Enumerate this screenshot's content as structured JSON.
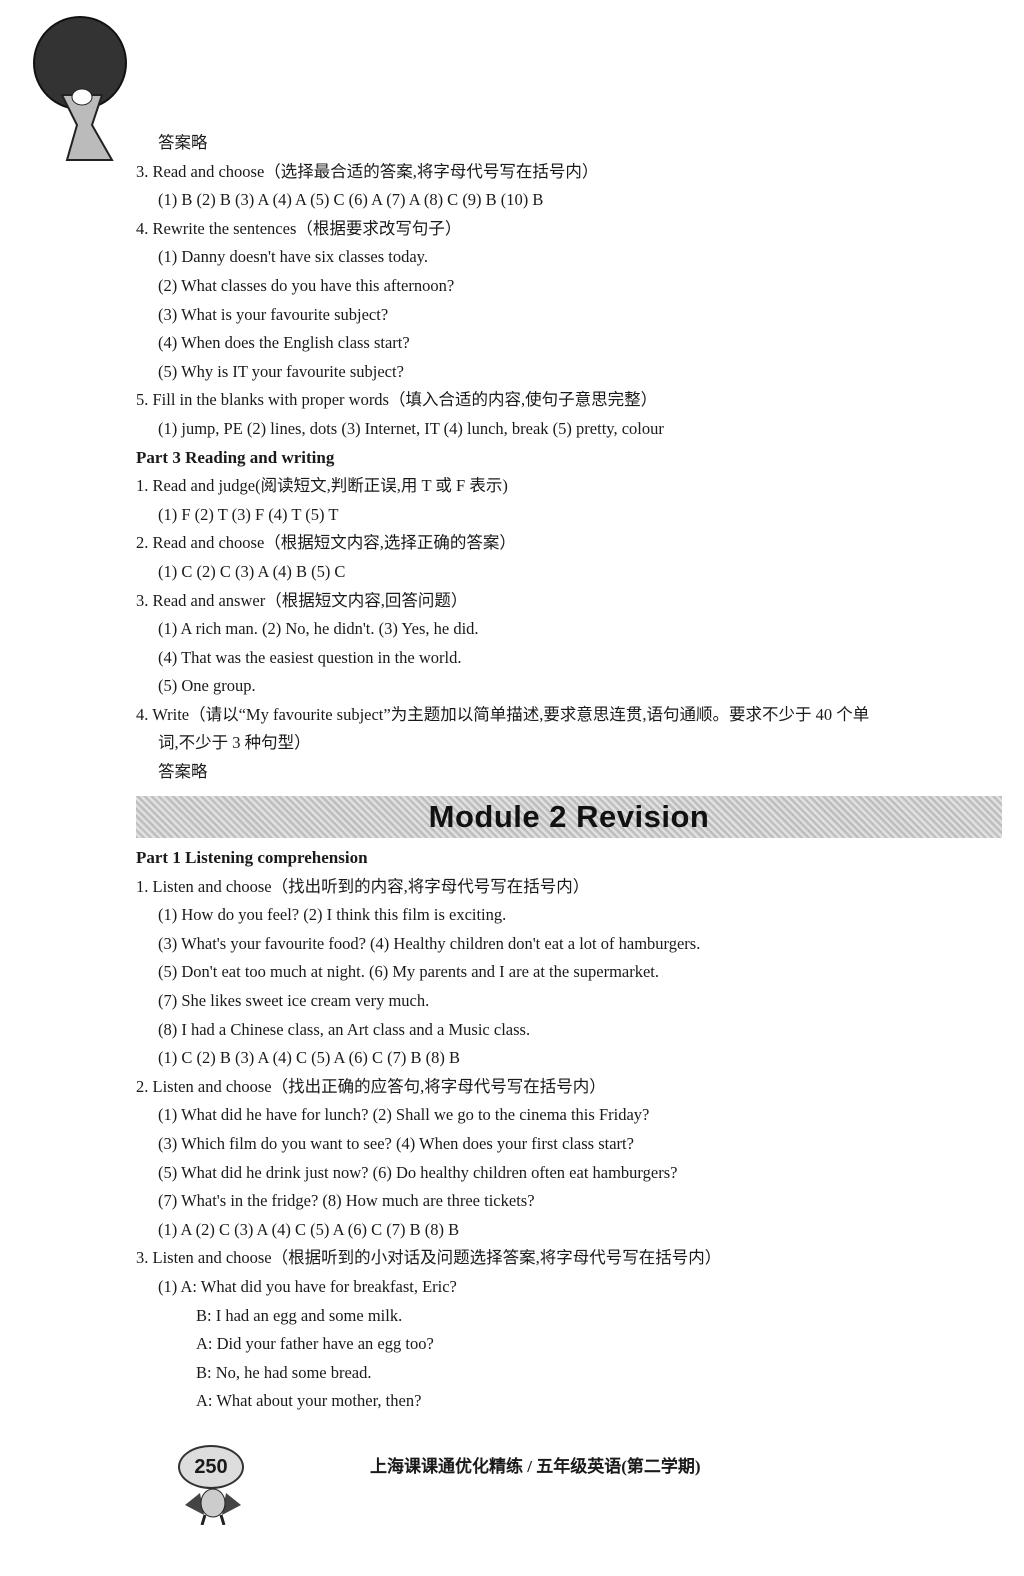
{
  "section_a": [
    {
      "t": "答案略",
      "c": "ind"
    },
    {
      "t": "3. Read and choose（选择最合适的答案,将字母代号写在括号内）",
      "c": ""
    },
    {
      "t": "(1) B   (2) B   (3) A   (4) A   (5) C   (6) A   (7) A   (8) C   (9) B   (10) B",
      "c": "ind"
    },
    {
      "t": "4. Rewrite the sentences（根据要求改写句子）",
      "c": ""
    },
    {
      "t": "(1)  Danny doesn't have six classes today.",
      "c": "ind"
    },
    {
      "t": "(2)  What classes do you have this afternoon?",
      "c": "ind"
    },
    {
      "t": "(3)  What is your favourite subject?",
      "c": "ind"
    },
    {
      "t": "(4)  When does the English class start?",
      "c": "ind"
    },
    {
      "t": "(5)  Why is IT your favourite subject?",
      "c": "ind"
    },
    {
      "t": "5. Fill in the blanks with proper words（填入合适的内容,使句子意思完整）",
      "c": ""
    },
    {
      "t": "(1) jump, PE   (2) lines, dots   (3) Internet, IT   (4) lunch, break   (5) pretty, colour",
      "c": "ind"
    },
    {
      "t": "Part 3    Reading and writing",
      "c": "head"
    },
    {
      "t": "1. Read and judge(阅读短文,判断正误,用 T 或 F 表示)",
      "c": ""
    },
    {
      "t": "(1) F   (2) T   (3) F   (4) T   (5) T",
      "c": "ind"
    },
    {
      "t": "2. Read and choose（根据短文内容,选择正确的答案）",
      "c": ""
    },
    {
      "t": "(1) C   (2) C   (3) A   (4) B   (5) C",
      "c": "ind"
    },
    {
      "t": "3. Read and answer（根据短文内容,回答问题）",
      "c": ""
    },
    {
      "t": "(1)  A rich man.   (2)  No, he didn't.   (3)  Yes, he did.",
      "c": "ind"
    },
    {
      "t": "(4)  That was the easiest question in the world.",
      "c": "ind"
    },
    {
      "t": "(5)  One group.",
      "c": "ind"
    },
    {
      "t": "4. Write（请以“My favourite subject”为主题加以简单描述,要求意思连贯,语句通顺。要求不少于 40 个单",
      "c": ""
    },
    {
      "t": "词,不少于 3 种句型）",
      "c": "ind"
    },
    {
      "t": "答案略",
      "c": "ind"
    }
  ],
  "module_title": "Module 2    Revision",
  "section_b": [
    {
      "t": "Part 1    Listening comprehension",
      "c": "head"
    },
    {
      "t": "1. Listen and choose（找出听到的内容,将字母代号写在括号内）",
      "c": ""
    },
    {
      "t": "(1)  How do you feel?    (2)  I think this film is exciting.",
      "c": "ind"
    },
    {
      "t": "(3)  What's your favourite food?    (4)  Healthy children don't eat a lot of hamburgers.",
      "c": "ind"
    },
    {
      "t": "(5)  Don't eat too much at night.    (6)  My parents and I are at the supermarket.",
      "c": "ind"
    },
    {
      "t": "(7)  She likes sweet ice cream very much.",
      "c": "ind"
    },
    {
      "t": "(8)  I had a Chinese class, an Art class and a Music class.",
      "c": "ind"
    },
    {
      "t": "(1) C   (2) B   (3) A   (4) C   (5) A   (6) C   (7) B   (8) B",
      "c": "ind"
    },
    {
      "t": "2. Listen and choose（找出正确的应答句,将字母代号写在括号内）",
      "c": ""
    },
    {
      "t": "(1)  What did he have for lunch?    (2)  Shall we go to the cinema this Friday?",
      "c": "ind"
    },
    {
      "t": "(3)  Which film do you want to see?    (4)  When does your first class start?",
      "c": "ind"
    },
    {
      "t": "(5)  What did he drink just now?    (6)  Do healthy children often eat hamburgers?",
      "c": "ind"
    },
    {
      "t": "(7)  What's in the fridge?    (8)  How much are three tickets?",
      "c": "ind"
    },
    {
      "t": "(1) A   (2) C   (3) A   (4) C   (5) A   (6) C   (7) B   (8) B",
      "c": "ind"
    },
    {
      "t": "3. Listen and choose（根据听到的小对话及问题选择答案,将字母代号写在括号内）",
      "c": ""
    },
    {
      "t": "(1)  A: What did you have for breakfast, Eric?",
      "c": "ind"
    },
    {
      "t": "B: I had an egg and some milk.",
      "c": "ind2"
    },
    {
      "t": "A: Did your father have an egg too?",
      "c": "ind2"
    },
    {
      "t": "B: No, he had some bread.",
      "c": "ind2"
    },
    {
      "t": "A: What about your mother, then?",
      "c": "ind2"
    }
  ],
  "footer": {
    "page_number": "250",
    "book_title": "上海课课通优化精练 / 五年级英语(第二学期)"
  }
}
